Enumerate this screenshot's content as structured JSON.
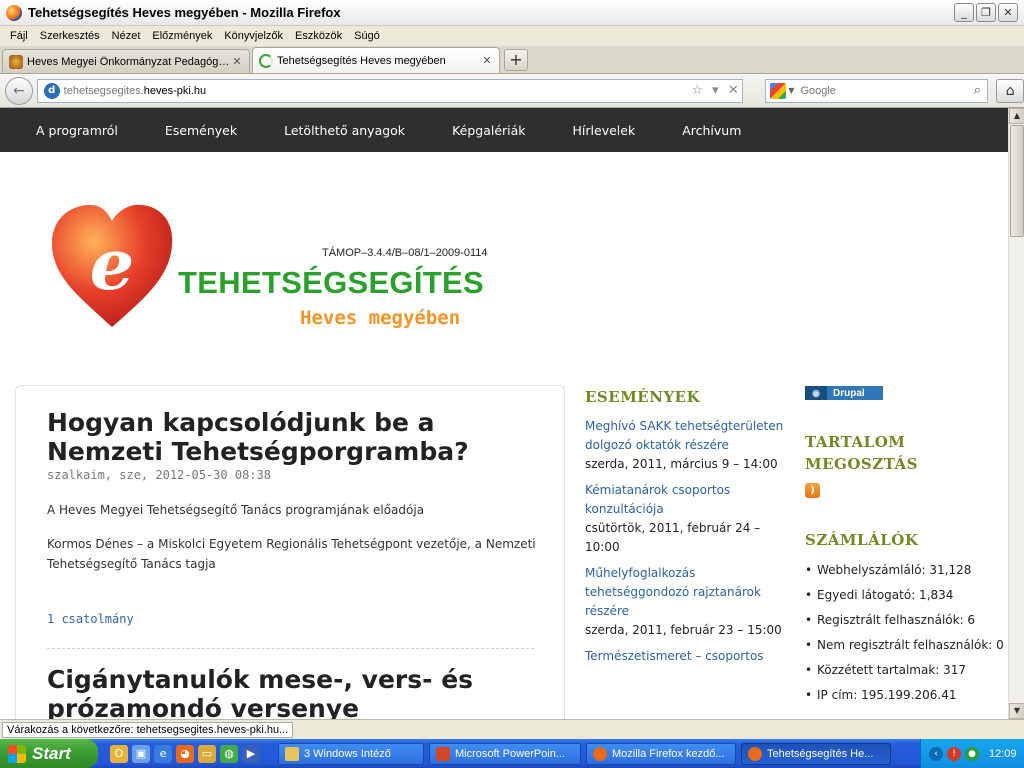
{
  "window": {
    "title": "Tehetségsegítés Heves megyében - Mozilla Firefox",
    "minimize_glyph": "_",
    "restore_glyph": "❐",
    "close_glyph": "✕"
  },
  "menu": [
    "Fájl",
    "Szerkesztés",
    "Nézet",
    "Előzmények",
    "Könyvjelzők",
    "Eszközök",
    "Súgó"
  ],
  "tabs": [
    {
      "label": "Heves Megyei Önkormányzat Pedagógiai ...",
      "active": false,
      "close": "✕"
    },
    {
      "label": "Tehetségsegítés Heves megyében",
      "active": true,
      "close": "✕"
    }
  ],
  "new_tab_glyph": "+",
  "navbar": {
    "back_glyph": "←",
    "url_prefix": "tehetsegsegites.",
    "url_domain": "heves-pki.hu",
    "star_glyph": "☆",
    "drop_glyph": "▾",
    "stop_glyph": "✕",
    "search_placeholder": "Google",
    "search_glyph": "⌕",
    "home_glyph": "⌂"
  },
  "site_nav": [
    "A programról",
    "Események",
    "Letölthető anyagok",
    "Képgalériák",
    "Hírlevelek",
    "Archívum"
  ],
  "logo": {
    "code": "TÁMOP–3.4.4/B–08/1–2009-0114",
    "main": "TEHETSÉGSEGÍTÉS",
    "sub": "Heves megyében",
    "letter": "e",
    "colors": {
      "heart": "#e8402a",
      "main": "#2aa12a",
      "sub": "#f39426"
    }
  },
  "articles": [
    {
      "title": "Hogyan kapcsolódjunk be a Nemzeti Tehetségporgramba?",
      "meta": "szalkaim, sze, 2012-05-30 08:38",
      "paragraphs": [
        "A Heves Megyei Tehetségsegítő Tanács programjának előadója",
        "Kormos Dénes – a Miskolci Egyetem Regionális Tehetségpont vezetője, a Nemzeti Tehetségsegítő Tanács tagja"
      ],
      "attachment": "1 csatolmány"
    },
    {
      "title": "Cigánytanulók mese-, vers- és prózamondó versenye"
    }
  ],
  "events": {
    "heading": "ESEMÉNYEK",
    "items": [
      {
        "title": "Meghívó SAKK tehetségterületen dolgozó oktatók részére",
        "date": "szerda, 2011, március 9 – 14:00"
      },
      {
        "title": "Kémiatanárok csoportos konzultációja",
        "date": "csütörtök, 2011, február 24 – 10:00"
      },
      {
        "title": "Műhelyfoglalkozás tehetséggondozó rajztanárok részére",
        "date": "szerda, 2011, február 23 – 15:00"
      },
      {
        "title": "Természetismeret – csoportos",
        "date": ""
      }
    ]
  },
  "drupal_badge": "Drupal",
  "share": {
    "heading_line1": "TARTALOM",
    "heading_line2": "MEGOSZTÁS",
    "rss_glyph": ")"
  },
  "counters": {
    "heading": "SZÁMLÁLÓK",
    "items": [
      "Webhelyszámláló: 31,128",
      "Egyedi látogató: 1,834",
      "Regisztrált felhasználók: 6",
      "Nem regisztrált felhasználók: 0",
      "Közzétett tartalmak: 317",
      "IP cím: 195.199.206.41"
    ]
  },
  "status_text": "Várakozás a következőre: tehetsegsegites.heves-pki.hu...",
  "taskbar": {
    "start": "Start",
    "tasks": [
      {
        "label": "3 Windows Intéző",
        "active": false
      },
      {
        "label": "Microsoft PowerPoin...",
        "active": false
      },
      {
        "label": "Mozilla Firefox kezdő...",
        "active": false
      },
      {
        "label": "Tehetségsegítés He...",
        "active": true
      }
    ],
    "clock": "12:09"
  }
}
